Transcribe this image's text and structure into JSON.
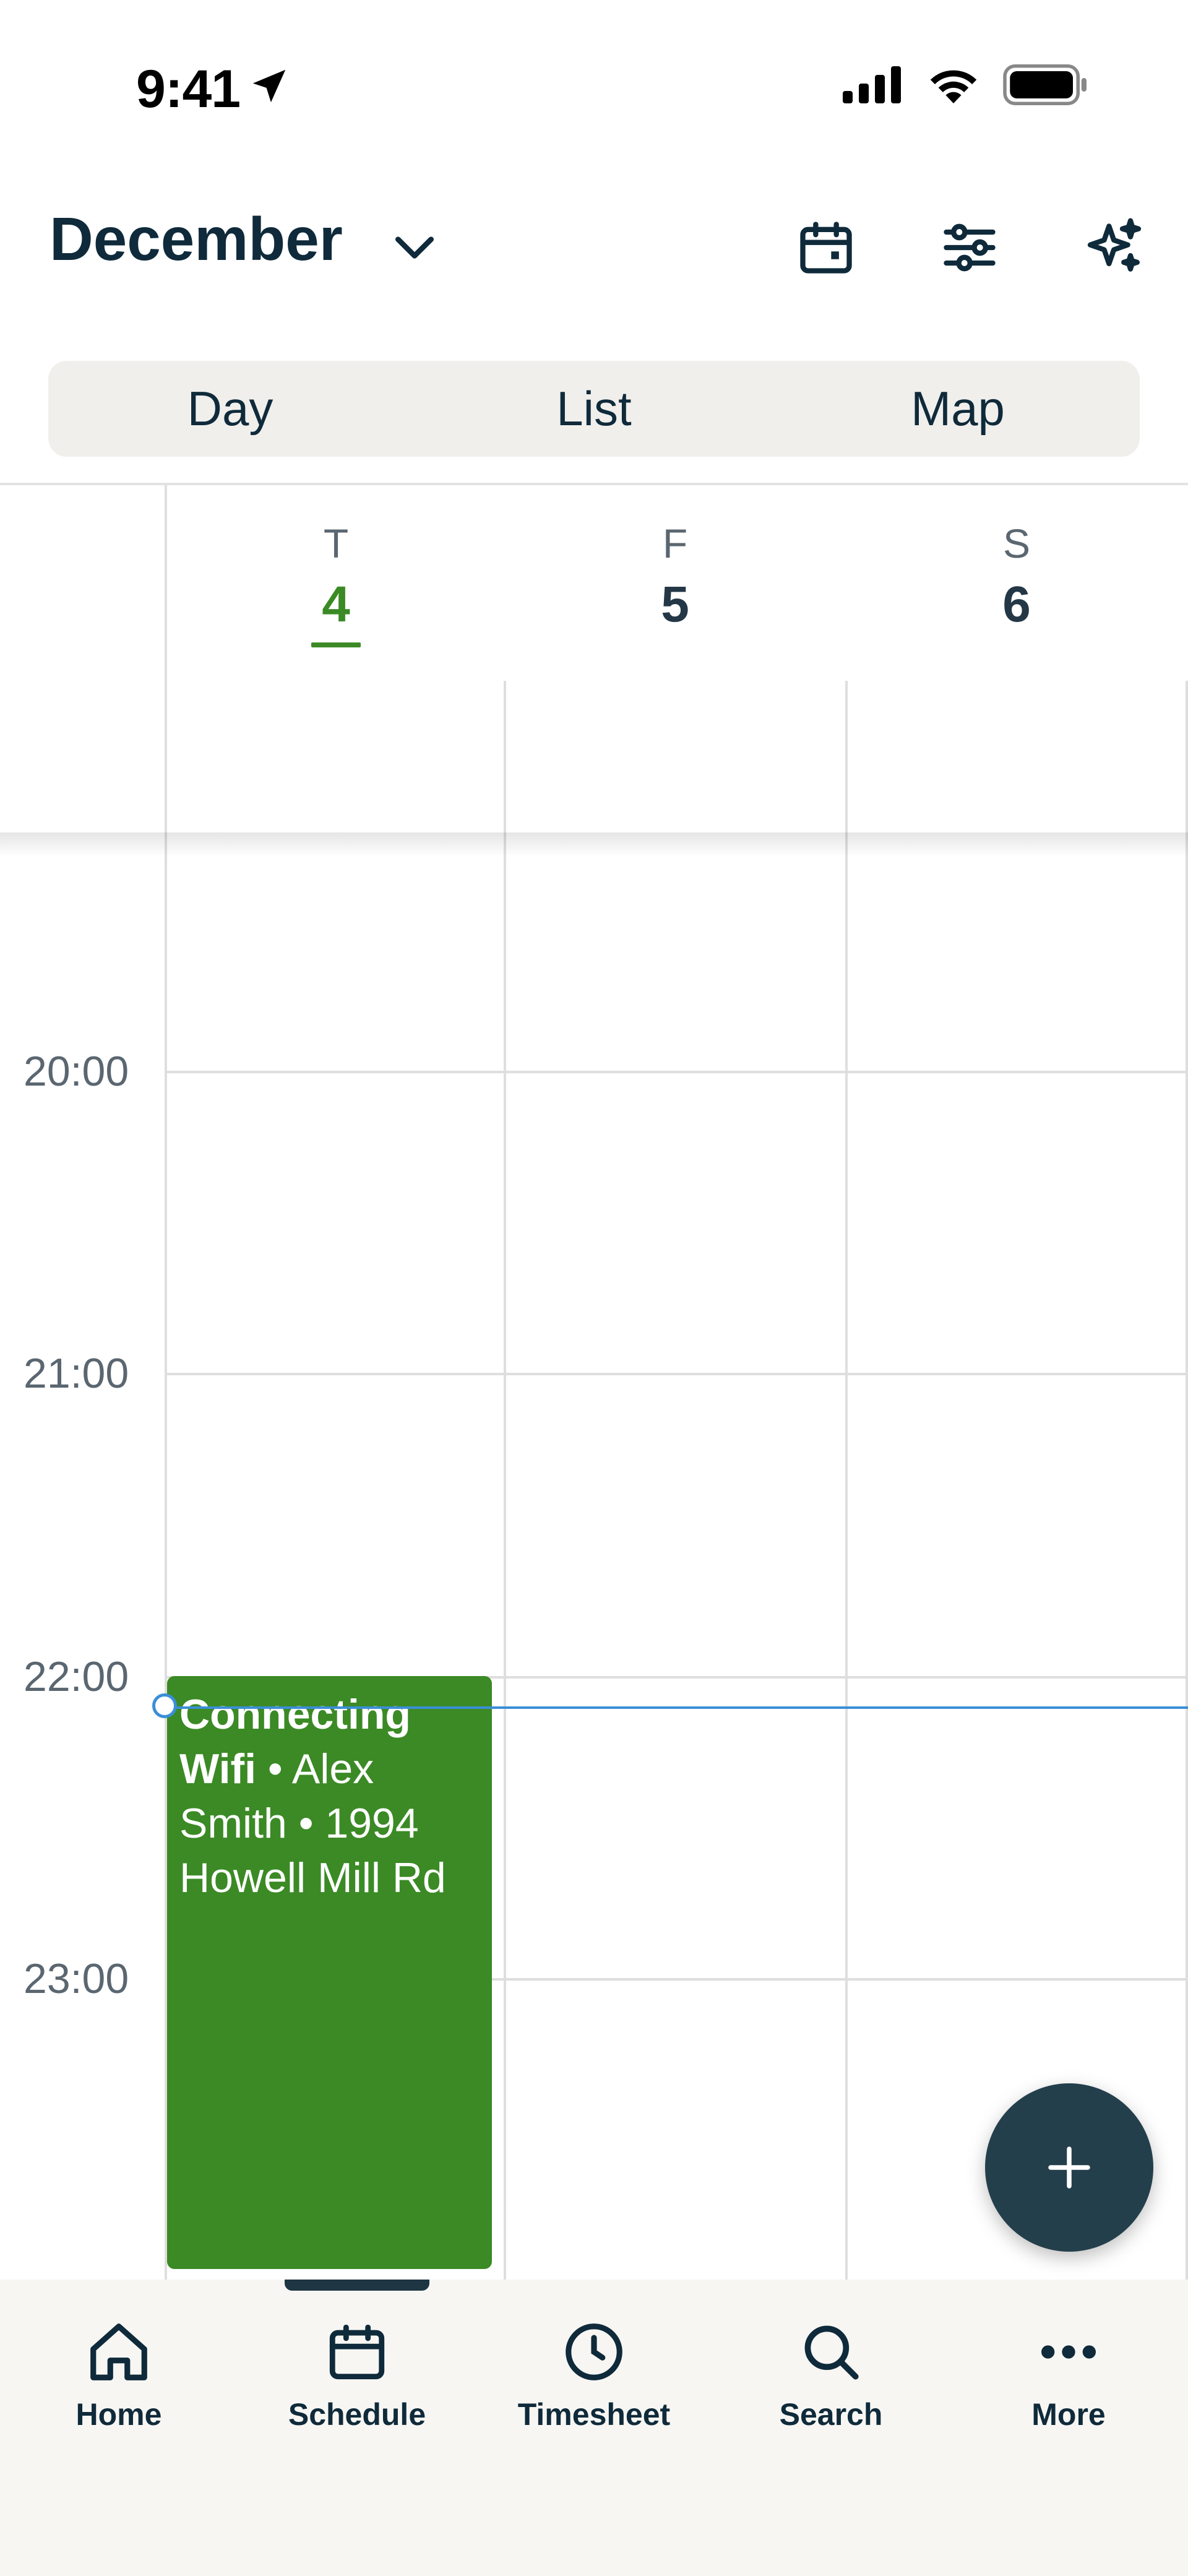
{
  "status_bar": {
    "time": "9:41"
  },
  "header": {
    "month": "December"
  },
  "view_tabs": [
    {
      "label": "Day"
    },
    {
      "label": "List"
    },
    {
      "label": "Map"
    }
  ],
  "days": [
    {
      "dow": "T",
      "date": "4"
    },
    {
      "dow": "F",
      "date": "5"
    },
    {
      "dow": "S",
      "date": "6"
    }
  ],
  "hours": [
    "20:00",
    "21:00",
    "22:00",
    "23:00"
  ],
  "event": {
    "title": "Connecting Wifi",
    "detail": " • Alex Smith • 1994 Howell Mill Rd",
    "color": "#3b8a25"
  },
  "bottom_nav": [
    {
      "label": "Home",
      "icon": "home-icon"
    },
    {
      "label": "Schedule",
      "icon": "calendar-icon"
    },
    {
      "label": "Timesheet",
      "icon": "clock-icon"
    },
    {
      "label": "Search",
      "icon": "search-icon"
    },
    {
      "label": "More",
      "icon": "more-icon"
    }
  ],
  "colors": {
    "accent": "#3b8a25",
    "primary": "#0f2a3a",
    "now": "#3a8fd6",
    "fab": "#243f4c"
  }
}
